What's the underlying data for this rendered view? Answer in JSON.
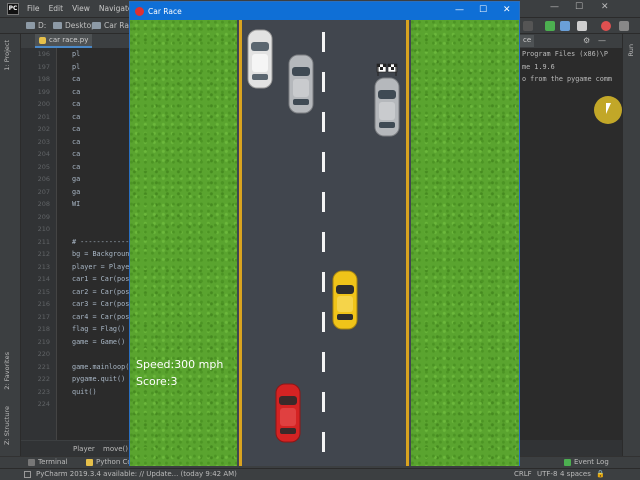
{
  "ide": {
    "menu": [
      "File",
      "Edit",
      "View",
      "Navigate"
    ],
    "breadcrumb": [
      "D:",
      "Desktop",
      "Car Race"
    ],
    "editor_tab": "car race.py",
    "left_tabs": [
      "1: Project",
      "2: Favorites",
      "Z: Structure"
    ],
    "line_numbers": [
      "196",
      "197",
      "198",
      "199",
      "200",
      "201",
      "202",
      "203",
      "204",
      "205",
      "206",
      "207",
      "208",
      "209",
      "210",
      "211",
      "212",
      "213",
      "214",
      "215",
      "216",
      "217",
      "218",
      "219",
      "220",
      "221",
      "222",
      "223",
      "224"
    ],
    "code_lines": [
      "pl",
      "pl",
      "ca",
      "ca",
      "ca",
      "ca",
      "ca",
      "ca",
      "ca",
      "ca",
      "ga",
      "ga",
      "WI",
      "",
      "",
      "# ------------",
      "bg = Background",
      "player = Player",
      "car1 = Car(pos",
      "car2 = Car(pos",
      "car3 = Car(pos",
      "car4 = Car(pos",
      "flag = Flag()",
      "game = Game()",
      "",
      "game.mainloop()",
      "pygame.quit()",
      "quit()"
    ],
    "editor_breadcrumb": [
      "Player",
      "move()"
    ],
    "run_tab": "Run",
    "run_panel_label": "ce",
    "console_lines": [
      "Program Files (x86)\\P",
      "me 1.9.6",
      "o from the pygame comm"
    ],
    "bottom_tabs": [
      "Terminal",
      "Python Con"
    ],
    "event_log": "Event Log",
    "status_message": "PyCharm 2019.3.4 available: // Update... (today 9:42 AM)",
    "status_right": [
      "CRLF",
      "UTF-8",
      "4 spaces"
    ]
  },
  "game": {
    "window_title": "Car Race",
    "speed_text": "Speed:300 mph",
    "score_text": "Score:3",
    "colors": {
      "grass": "#5aa42f",
      "road": "#41464e",
      "edge_line": "#d9a31f",
      "lane_dash": "#f4f4f4",
      "titlebar": "#0f6fd6"
    },
    "cars": [
      {
        "name": "white-car",
        "color": "#e2e2e2"
      },
      {
        "name": "silver-car",
        "color": "#b5b8bc"
      },
      {
        "name": "silver-car",
        "color": "#b5b8bc"
      },
      {
        "name": "yellow-player-car",
        "color": "#f0c419"
      },
      {
        "name": "red-car",
        "color": "#d42323"
      }
    ],
    "finish_flag_icon": "checkered-flag-icon"
  }
}
